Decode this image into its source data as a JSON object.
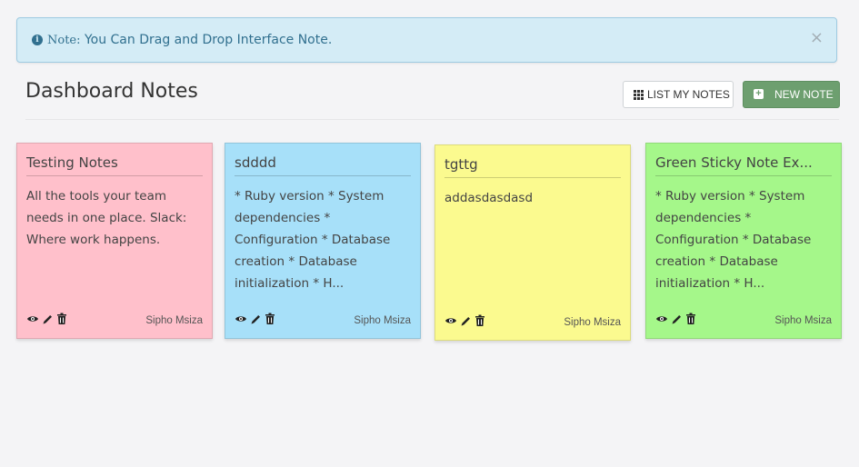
{
  "alert": {
    "prefix": "Note:",
    "message": "You Can Drag and Drop Interface Note.",
    "close": "×",
    "info_glyph": "i"
  },
  "page": {
    "title": "Dashboard Notes"
  },
  "toolbar": {
    "list_label": "LIST MY NOTES",
    "new_label": "NEW NOTE",
    "new_glyph": "+"
  },
  "notes": [
    {
      "title": "Testing Notes",
      "body": "All the tools your team needs in one place. Slack: Where work happens.",
      "author": "Sipho Msiza",
      "color": "#ffc0cb"
    },
    {
      "title": "sdddd",
      "body": "* Ruby version * System dependencies * Configuration * Database creation * Database initialization * H...",
      "author": "Sipho Msiza",
      "color": "#a7e0f9"
    },
    {
      "title": "tgttg",
      "body": "addasdasdasd",
      "author": "Sipho Msiza",
      "color": "#fbfa8f"
    },
    {
      "title": "Green Sticky Note Ex...",
      "body": "* Ruby version * System dependencies * Configuration * Database creation * Database initialization * H...",
      "author": "Sipho Msiza",
      "color": "#a5f78a"
    }
  ],
  "icons": {
    "view": "eye-icon",
    "edit": "pencil-icon",
    "delete": "trash-icon",
    "info": "info-circle-icon",
    "list": "grid-icon",
    "new": "plus-square-icon"
  }
}
